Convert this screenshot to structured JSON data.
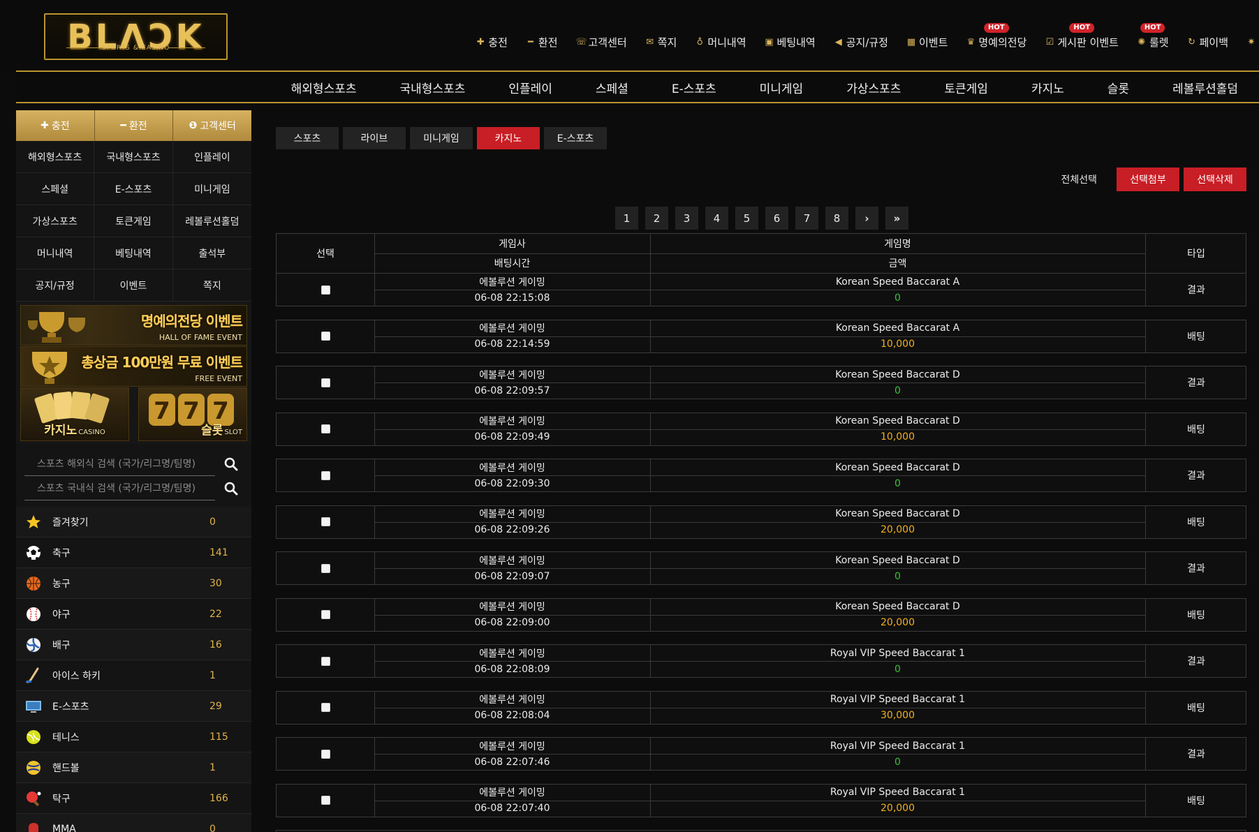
{
  "logo": {
    "main": "BLΛƆK",
    "sub": "SPORTS & CASINO"
  },
  "top_links": [
    {
      "label": "충전",
      "icon": "plus-icon",
      "glyph": "✚",
      "hot": false
    },
    {
      "label": "환전",
      "icon": "minus-icon",
      "glyph": "━",
      "hot": false
    },
    {
      "label": "고객센터",
      "icon": "headset-icon",
      "glyph": "☏",
      "hot": false
    },
    {
      "label": "쪽지",
      "icon": "envelope-icon",
      "glyph": "✉",
      "hot": false
    },
    {
      "label": "머니내역",
      "icon": "money-bag-icon",
      "glyph": "♁",
      "hot": false
    },
    {
      "label": "베팅내역",
      "icon": "ticket-icon",
      "glyph": "▣",
      "hot": false
    },
    {
      "label": "공지/규정",
      "icon": "megaphone-icon",
      "glyph": "◀",
      "hot": false
    },
    {
      "label": "이벤트",
      "icon": "gift-icon",
      "glyph": "▦",
      "hot": false
    },
    {
      "label": "명예의전당",
      "icon": "trophy-icon",
      "glyph": "♛",
      "hot": true
    },
    {
      "label": "게시판 이벤트",
      "icon": "checkbox-icon",
      "glyph": "☑",
      "hot": true
    },
    {
      "label": "룰렛",
      "icon": "roulette-icon",
      "glyph": "✺",
      "hot": true
    },
    {
      "label": "페이백",
      "icon": "refresh-icon",
      "glyph": "↻",
      "hot": false
    }
  ],
  "hot_label": "HOT",
  "main_nav": [
    "해외형스포츠",
    "국내형스포츠",
    "인플레이",
    "스페셜",
    "E-스포츠",
    "미니게임",
    "가상스포츠",
    "토큰게임",
    "카지노",
    "슬롯",
    "레볼루션홀덤"
  ],
  "sidebar": {
    "buttons": [
      {
        "label": "충전",
        "icon": "plus-icon",
        "glyph": "✚"
      },
      {
        "label": "환전",
        "icon": "minus-icon",
        "glyph": "━"
      },
      {
        "label": "고객센터",
        "icon": "info-icon",
        "glyph": "❶"
      }
    ],
    "grid": [
      "해외형스포츠",
      "국내형스포츠",
      "인플레이",
      "스페셜",
      "E-스포츠",
      "미니게임",
      "가상스포츠",
      "토큰게임",
      "레볼루션홀덤",
      "머니내역",
      "베팅내역",
      "출석부",
      "공지/규정",
      "이벤트",
      "쪽지"
    ],
    "banners": [
      {
        "title": "명예의전당 이벤트",
        "sub": "HALL OF FAME EVENT"
      },
      {
        "title": "총상금 100만원 무료 이벤트",
        "sub": "FREE EVENT"
      }
    ],
    "mini_banners": [
      {
        "title": "카지노",
        "sub": "CASINO"
      },
      {
        "title": "슬롯",
        "sub": "SLOT"
      }
    ],
    "search": [
      {
        "placeholder": "스포츠 해외식 검색 (국가/리그명/팀명)"
      },
      {
        "placeholder": "스포츠 국내식 검색 (국가/리그명/팀명)"
      }
    ],
    "sports": [
      {
        "name": "즐겨찾기",
        "count": "0",
        "icon": "star-icon"
      },
      {
        "name": "축구",
        "count": "141",
        "icon": "soccer-ball-icon"
      },
      {
        "name": "농구",
        "count": "30",
        "icon": "basketball-icon"
      },
      {
        "name": "야구",
        "count": "22",
        "icon": "baseball-icon"
      },
      {
        "name": "배구",
        "count": "16",
        "icon": "volleyball-icon"
      },
      {
        "name": "아이스 하키",
        "count": "1",
        "icon": "hockey-stick-icon"
      },
      {
        "name": "E-스포츠",
        "count": "29",
        "icon": "monitor-icon"
      },
      {
        "name": "테니스",
        "count": "115",
        "icon": "tennis-ball-icon"
      },
      {
        "name": "핸드볼",
        "count": "1",
        "icon": "handball-icon"
      },
      {
        "name": "탁구",
        "count": "166",
        "icon": "ping-pong-icon"
      },
      {
        "name": "MMA",
        "count": "0",
        "icon": "glove-icon"
      }
    ]
  },
  "content": {
    "tabs": [
      "스포츠",
      "라이브",
      "미니게임",
      "카지노",
      "E-스포츠"
    ],
    "active_tab": 3,
    "select_all": "전체선택",
    "btn_attach": "선택첨부",
    "btn_delete": "선택삭제",
    "pages": [
      "1",
      "2",
      "3",
      "4",
      "5",
      "6",
      "7",
      "8",
      "›",
      "»"
    ],
    "header": {
      "select": "선택",
      "provider": "게임사",
      "bet_time": "배팅시간",
      "game_name": "게임명",
      "amount": "금액",
      "type": "타입"
    },
    "rows": [
      {
        "provider": "에볼루션 게이밍",
        "time": "06-08 22:15:08",
        "game": "Korean Speed Baccarat A",
        "amount": "0",
        "type": "결과"
      },
      {
        "provider": "에볼루션 게이밍",
        "time": "06-08 22:14:59",
        "game": "Korean Speed Baccarat A",
        "amount": "10,000",
        "type": "배팅"
      },
      {
        "provider": "에볼루션 게이밍",
        "time": "06-08 22:09:57",
        "game": "Korean Speed Baccarat D",
        "amount": "0",
        "type": "결과"
      },
      {
        "provider": "에볼루션 게이밍",
        "time": "06-08 22:09:49",
        "game": "Korean Speed Baccarat D",
        "amount": "10,000",
        "type": "배팅"
      },
      {
        "provider": "에볼루션 게이밍",
        "time": "06-08 22:09:30",
        "game": "Korean Speed Baccarat D",
        "amount": "0",
        "type": "결과"
      },
      {
        "provider": "에볼루션 게이밍",
        "time": "06-08 22:09:26",
        "game": "Korean Speed Baccarat D",
        "amount": "20,000",
        "type": "배팅"
      },
      {
        "provider": "에볼루션 게이밍",
        "time": "06-08 22:09:07",
        "game": "Korean Speed Baccarat D",
        "amount": "0",
        "type": "결과"
      },
      {
        "provider": "에볼루션 게이밍",
        "time": "06-08 22:09:00",
        "game": "Korean Speed Baccarat D",
        "amount": "20,000",
        "type": "배팅"
      },
      {
        "provider": "에볼루션 게이밍",
        "time": "06-08 22:08:09",
        "game": "Royal VIP Speed Baccarat 1",
        "amount": "0",
        "type": "결과"
      },
      {
        "provider": "에볼루션 게이밍",
        "time": "06-08 22:08:04",
        "game": "Royal VIP Speed Baccarat 1",
        "amount": "30,000",
        "type": "배팅"
      },
      {
        "provider": "에볼루션 게이밍",
        "time": "06-08 22:07:46",
        "game": "Royal VIP Speed Baccarat 1",
        "amount": "0",
        "type": "결과"
      },
      {
        "provider": "에볼루션 게이밍",
        "time": "06-08 22:07:40",
        "game": "Royal VIP Speed Baccarat 1",
        "amount": "20,000",
        "type": "배팅"
      }
    ]
  },
  "colors": {
    "gold": "#b9942e",
    "red": "#c81e25",
    "zero_amount": "#3fbf3a",
    "bet_amount": "#f0b020"
  }
}
